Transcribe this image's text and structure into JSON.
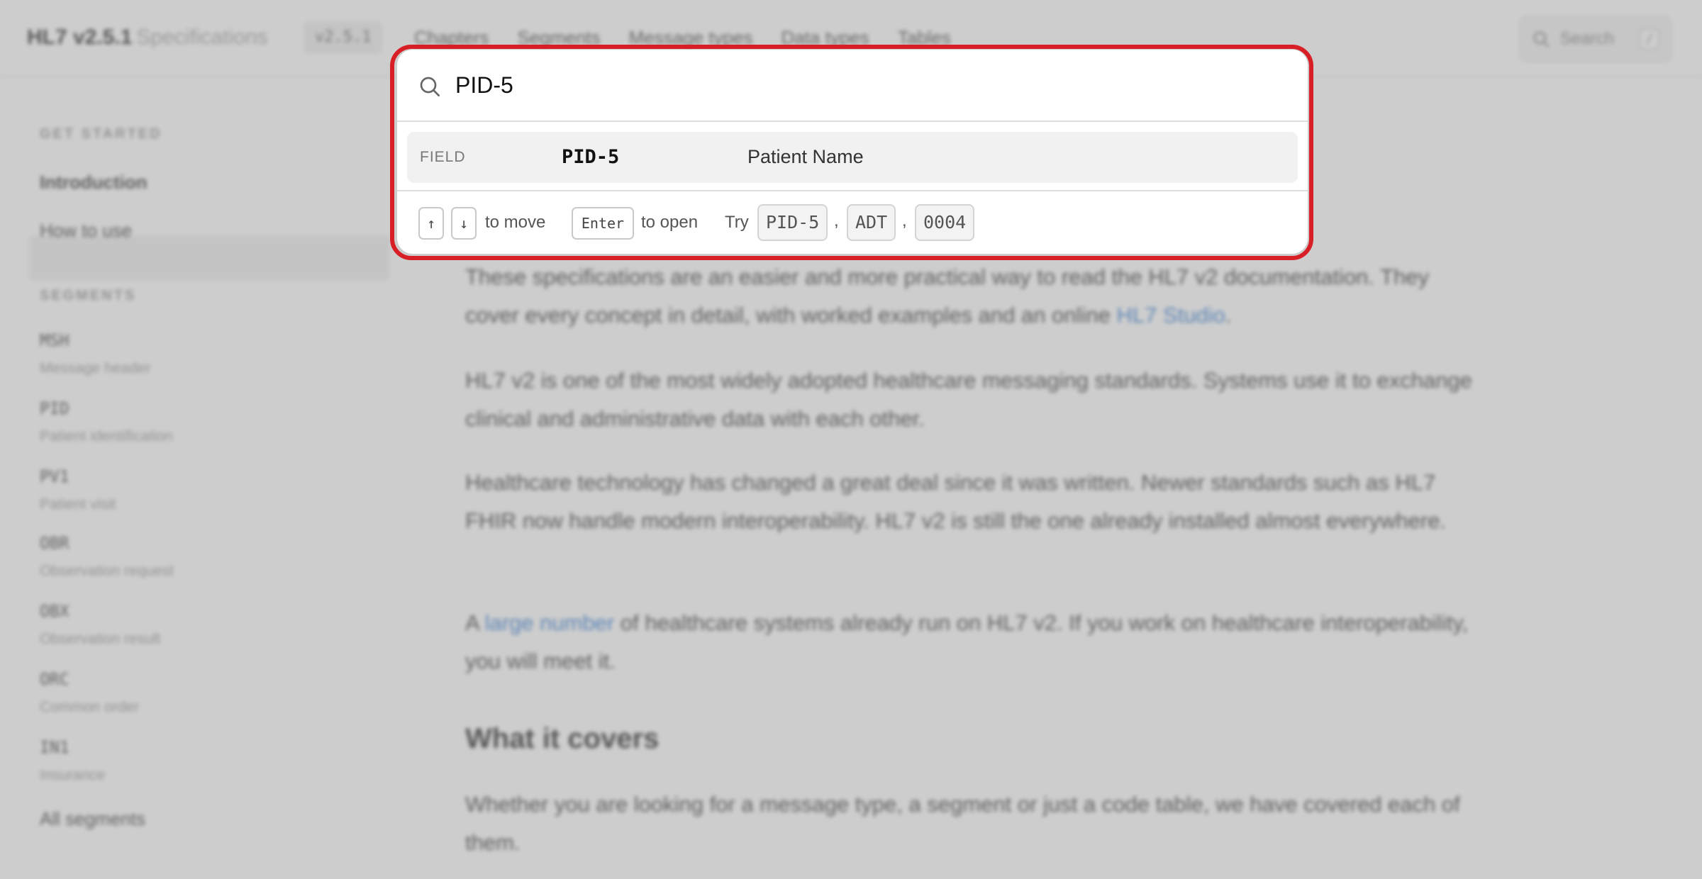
{
  "header": {
    "brand": "HL7 v2.5.1",
    "brand_sub": "Specifications",
    "version": "v2.5.1",
    "nav": [
      "Chapters",
      "Segments",
      "Message types",
      "Data types",
      "Tables"
    ],
    "search_label": "Search",
    "search_shortcut": "/"
  },
  "sidebar": {
    "get_started_heading": "GET STARTED",
    "introduction": "Introduction",
    "how_to_use": "How to use",
    "segments_heading": "SEGMENTS",
    "segments": [
      {
        "code": "MSH",
        "desc": "Message header"
      },
      {
        "code": "PID",
        "desc": "Patient identification"
      },
      {
        "code": "PV1",
        "desc": "Patient visit"
      },
      {
        "code": "OBR",
        "desc": "Observation request"
      },
      {
        "code": "OBX",
        "desc": "Observation result"
      },
      {
        "code": "ORC",
        "desc": "Common order"
      },
      {
        "code": "IN1",
        "desc": "Insurance"
      }
    ],
    "all_segments": "All segments"
  },
  "content": {
    "p1_a": "These specifications are an easier and more practical way to read the HL7 v2 documentation. They cover every concept in detail, with worked examples and an online ",
    "p1_link": "HL7 Studio",
    "p1_b": ".",
    "p2": "HL7 v2 is one of the most widely adopted healthcare messaging standards. Systems use it to exchange clinical and administrative data with each other.",
    "p3": "Healthcare technology has changed a great deal since it was written. Newer standards such as HL7 FHIR now handle modern interoperability. HL7 v2 is still the one already installed almost everywhere.",
    "p4_a": "A ",
    "p4_link": "large number",
    "p4_b": " of healthcare systems already run on HL7 v2. If you work on healthcare interoperability, you will meet it.",
    "h2": "What it covers",
    "p5": "Whether you are looking for a message type, a segment or just a code table, we have covered each of them."
  },
  "palette": {
    "query": "PID-5",
    "result": {
      "kind": "FIELD",
      "code": "PID-5",
      "name": "Patient Name"
    },
    "footer": {
      "key_up": "↑",
      "key_down": "↓",
      "to_move": "to move",
      "key_enter": "Enter",
      "to_open": "to open",
      "try": "Try",
      "examples": [
        "PID-5",
        "ADT",
        "0004"
      ],
      "separator": ","
    }
  },
  "colors": {
    "highlight_ring": "#d91f26",
    "link": "#1f6fd0"
  }
}
